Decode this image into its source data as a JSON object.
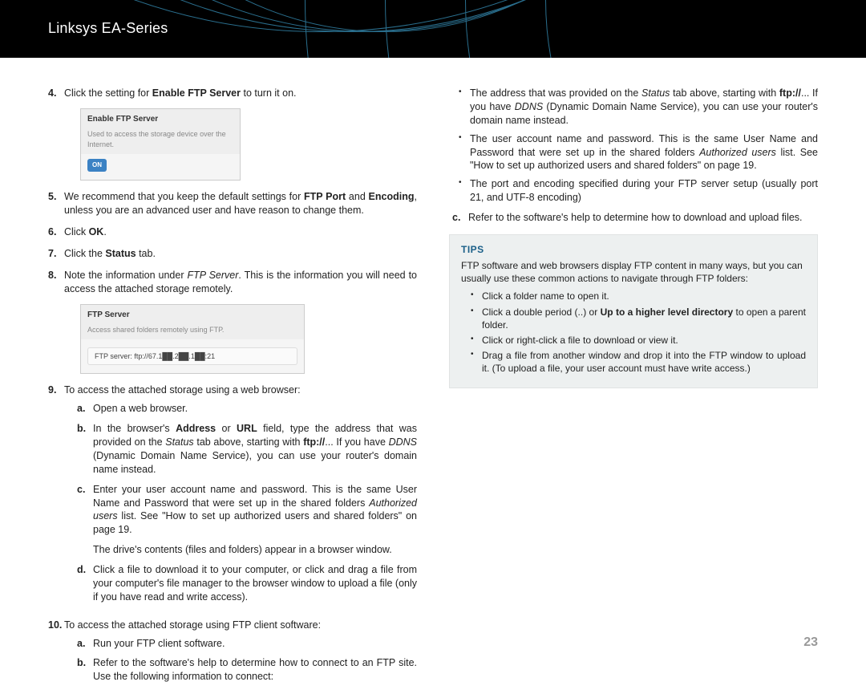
{
  "header": {
    "title": "Linksys EA-Series"
  },
  "page_number": "23",
  "left": {
    "step4_num": "4.",
    "step4_a": "Click the setting for ",
    "step4_b": "Enable FTP Server",
    "step4_c": " to turn it on.",
    "ss1": {
      "title": "Enable FTP Server",
      "subtitle": "Used to access the storage device over the Internet.",
      "toggle": "ON"
    },
    "step5_num": "5.",
    "step5_a": "We recommend that you keep the default settings for ",
    "step5_b": "FTP Port",
    "step5_c": " and ",
    "step5_d": "Encoding",
    "step5_e": ", unless you are an advanced user and have reason to change them.",
    "step6_num": "6.",
    "step6_a": "Click ",
    "step6_b": "OK",
    "step6_c": ".",
    "step7_num": "7.",
    "step7_a": "Click the ",
    "step7_b": "Status",
    "step7_c": " tab.",
    "step8_num": "8.",
    "step8_a": "Note the information under ",
    "step8_b": "FTP Server",
    "step8_c": ". This is the information you will need to access the attached storage remotely.",
    "ss2": {
      "title": "FTP Server",
      "subtitle": "Access shared folders remotely using FTP.",
      "field": "FTP server: ftp://67.1██.2██.1██:21"
    },
    "step9_num": "9.",
    "step9_text": "To access the attached storage using a web browser:",
    "s9a_num": "a.",
    "s9a_text": "Open a web browser.",
    "s9b_num": "b.",
    "s9b_a": "In the browser's ",
    "s9b_b": "Address",
    "s9b_c": " or ",
    "s9b_d": "URL",
    "s9b_e": " field, type the address that was provided on the ",
    "s9b_f": "Status",
    "s9b_g": " tab above, starting with ",
    "s9b_h": "ftp://",
    "s9b_i": "... If you have ",
    "s9b_j": "DDNS",
    "s9b_k": " (Dynamic Domain Name Service), you can use your router's domain name instead.",
    "s9c_num": "c.",
    "s9c_a": "Enter your user account name and password. This is the same User Name and Password that were set up in the shared folders ",
    "s9c_b": "Authorized users",
    "s9c_c": " list. See \"How to set up authorized users and shared folders\" on page 19.",
    "s9c_note": "The drive's contents (files and folders) appear in a browser window.",
    "s9d_num": "d.",
    "s9d_text": "Click a file to download it to your computer, or click and drag a file from your computer's file manager to the browser window to upload a file (only if you have read and write access).",
    "step10_num": "10.",
    "step10_text": "To access the attached storage using FTP client software:",
    "s10a_num": "a.",
    "s10a_text": "Run your FTP client software.",
    "s10b_num": "b.",
    "s10b_text": "Refer to the software's help to determine how to connect to an FTP site. Use the following information to connect:"
  },
  "right": {
    "b1_a": "The address that was provided on the ",
    "b1_b": "Status",
    "b1_c": " tab above, starting with ",
    "b1_d": "ftp://",
    "b1_e": "...  If you have ",
    "b1_f": "DDNS",
    "b1_g": " (Dynamic Domain Name Service), you can use your router's domain name instead.",
    "b2_a": "The user account name and password. This is the same User Name and Password that were set up in the shared folders ",
    "b2_b": "Authorized users",
    "b2_c": " list. See \"How to set up authorized users and shared folders\" on page 19.",
    "b3": "The port and encoding specified during your FTP server setup (usually port 21, and UTF-8 encoding)",
    "c_num": "c.",
    "c_text": "Refer to the software's help to determine how to download and upload files.",
    "tips_title": "TIPS",
    "tips_intro": "FTP software and web browsers display FTP content in many ways, but you can usually use these common actions to navigate through FTP folders:",
    "t1": "Click a folder name to open it.",
    "t2_a": "Click a double period (..) or ",
    "t2_b": "Up to a higher level directory",
    "t2_c": " to open a parent folder.",
    "t3": "Click or right-click a file to download or view it.",
    "t4": "Drag a file from another window and drop it into the FTP window to upload it. (To upload a file, your user account must have write access.)"
  }
}
